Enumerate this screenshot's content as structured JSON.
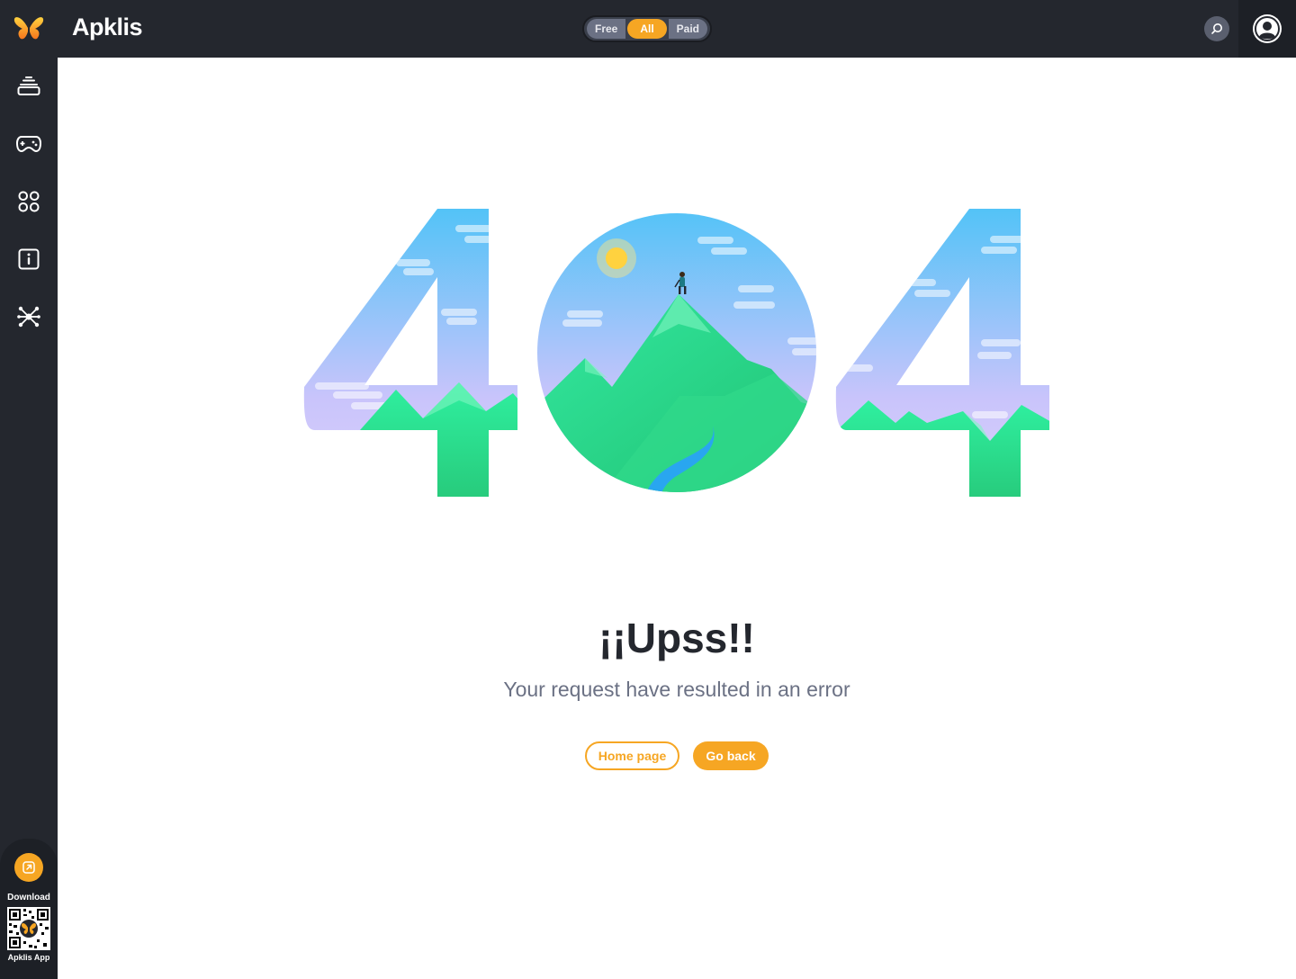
{
  "app": {
    "brand": "Apklis"
  },
  "header": {
    "filter_options": [
      {
        "label": "Free",
        "active": false
      },
      {
        "label": "All",
        "active": true
      },
      {
        "label": "Paid",
        "active": false
      }
    ],
    "search_icon": "search-icon",
    "avatar_icon": "user-icon"
  },
  "sidebar": {
    "items": [
      {
        "icon": "apps-stack-icon"
      },
      {
        "icon": "gamepad-icon"
      },
      {
        "icon": "categories-grid-icon"
      },
      {
        "icon": "info-icon"
      },
      {
        "icon": "developers-network-icon"
      }
    ],
    "download": {
      "label": "Download",
      "app_label": "Apklis App",
      "icon": "external-link-icon"
    }
  },
  "error": {
    "illustration_text": "404",
    "title": "¡¡Upss!!",
    "message": "Your request have resulted in an error",
    "buttons": {
      "home": "Home page",
      "back": "Go back"
    }
  },
  "colors": {
    "accent": "#f6a623",
    "dark": "#24272e",
    "muted": "#6b7184"
  }
}
